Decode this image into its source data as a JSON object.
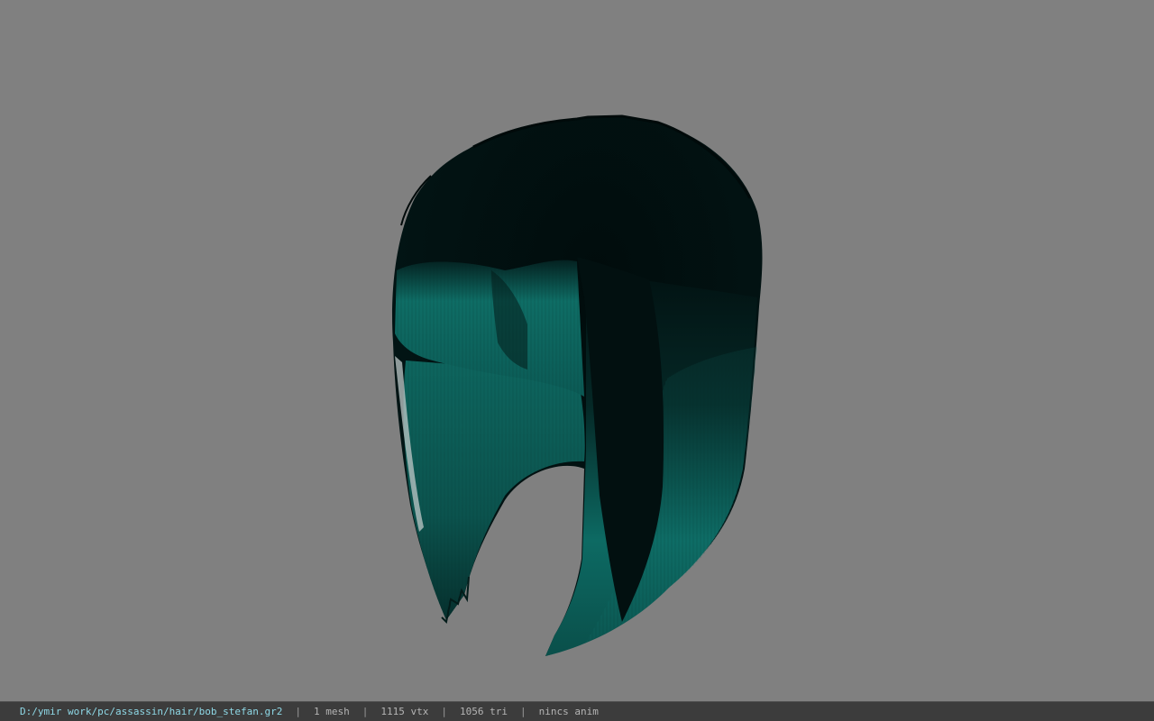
{
  "viewport": {
    "background_color": "#808080",
    "model_name": "bob_stefan",
    "hair_color_dark": "#021212",
    "hair_color_light": "#0f7068"
  },
  "statusbar": {
    "file_path": "D:/ymir work/pc/assassin/hair/bob_stefan.gr2",
    "separator": "|",
    "mesh_count": "1 mesh",
    "vertex_count": "1115 vtx",
    "triangle_count": "1056 tri",
    "anim_status": "nincs anim"
  }
}
